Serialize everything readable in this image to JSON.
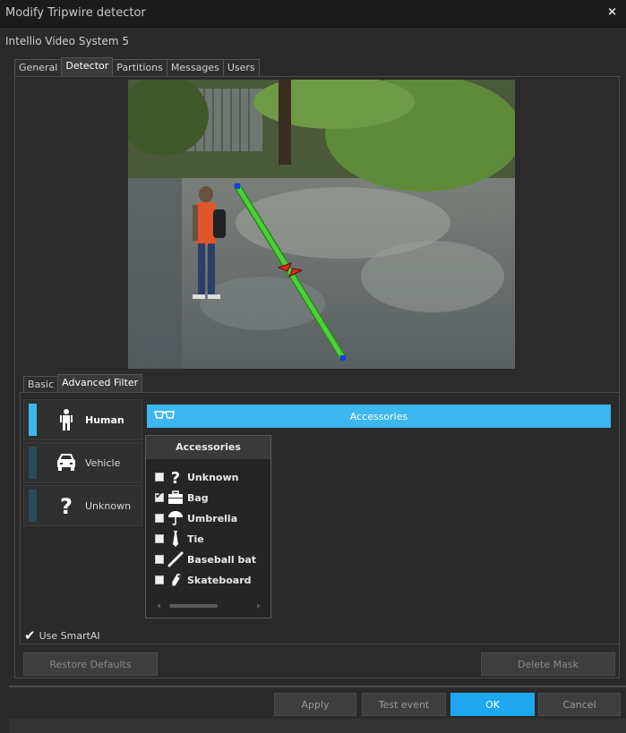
{
  "window": {
    "title": "Modify Tripwire detector",
    "close_label": "×"
  },
  "subtitle": "Intellio Video System 5",
  "tabs": [
    {
      "label": "General"
    },
    {
      "label": "Detector"
    },
    {
      "label": "Partitions"
    },
    {
      "label": "Messages"
    },
    {
      "label": "Users"
    }
  ],
  "subtabs": [
    {
      "label": "Basic"
    },
    {
      "label": "Advanced Filter"
    }
  ],
  "categories": [
    {
      "label": "Human",
      "icon": "person-icon",
      "active": true
    },
    {
      "label": "Vehicle",
      "icon": "car-icon",
      "active": false
    },
    {
      "label": "Unknown",
      "icon": "question-icon",
      "active": false
    }
  ],
  "accessories_header": {
    "label": "Accessories",
    "icon": "glasses-icon"
  },
  "accessories_panel": {
    "title": "Accessories",
    "items": [
      {
        "label": "Unknown",
        "checked": false,
        "icon": "question-icon"
      },
      {
        "label": "Bag",
        "checked": true,
        "icon": "briefcase-icon"
      },
      {
        "label": "Umbrella",
        "checked": false,
        "icon": "umbrella-icon"
      },
      {
        "label": "Tie",
        "checked": false,
        "icon": "tie-icon"
      },
      {
        "label": "Baseball bat",
        "checked": false,
        "icon": "baseball-bat-icon"
      },
      {
        "label": "Skateboard",
        "checked": false,
        "icon": "skateboard-icon"
      }
    ]
  },
  "use_smartai": {
    "label": "Use SmartAI",
    "checked": true
  },
  "buttons": {
    "restore_defaults": "Restore Defaults",
    "delete_mask": "Delete Mask",
    "apply": "Apply",
    "test_event": "Test event",
    "ok": "OK",
    "cancel": "Cancel"
  },
  "colors": {
    "accent": "#3db7ef",
    "tripwire": "#4ccf3a",
    "direction_arrow": "#e0261b"
  }
}
